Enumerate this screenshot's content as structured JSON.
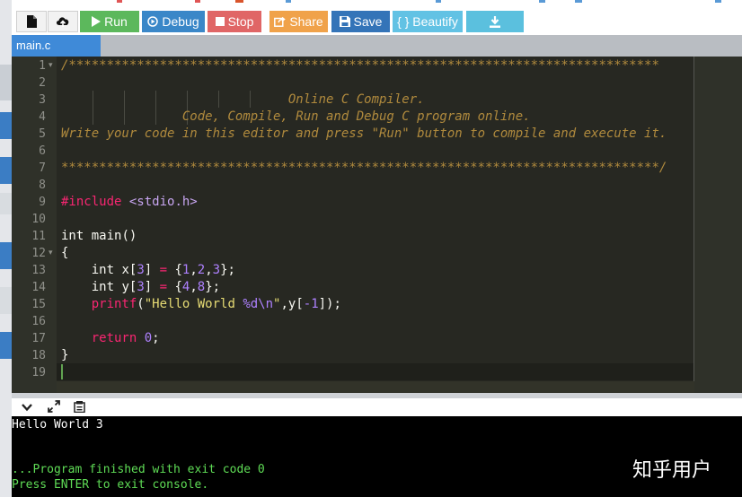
{
  "toolbar": {
    "new_file_icon": "file-icon",
    "upload_icon": "upload-icon",
    "run_label": "Run",
    "debug_label": "Debug",
    "stop_label": "Stop",
    "share_label": "Share",
    "save_label": "Save",
    "beautify_label": "{ } Beautify",
    "download_icon": "download-icon",
    "colors": {
      "run": "#5cb85c",
      "debug": "#3a87c8",
      "stop": "#e06666",
      "share": "#f0a24a",
      "save": "#3474b8",
      "beautify": "#62c2e4",
      "download": "#5bc0de"
    }
  },
  "tabs": [
    {
      "label": "main.c",
      "active": true
    }
  ],
  "editor": {
    "line_numbers": [
      "1",
      "2",
      "3",
      "4",
      "5",
      "6",
      "7",
      "8",
      "9",
      "10",
      "11",
      "12",
      "13",
      "14",
      "15",
      "16",
      "17",
      "18",
      "19"
    ],
    "fold_markers": [
      "1",
      "12"
    ],
    "code": {
      "l1": "/******************************************************************************",
      "l3": "                              Online C Compiler.",
      "l4": "                Code, Compile, Run and Debug C program online.",
      "l5": "Write your code in this editor and press \"Run\" button to compile and execute it.",
      "l7": "*******************************************************************************/",
      "l9_directive": "#include",
      "l9_header": "<stdio.h>",
      "l11_type": "int",
      "l11_rest": " main()",
      "l12": "{",
      "l13_type": "int",
      "l13_a": " x[",
      "l13_n": "3",
      "l13_b": "] ",
      "l13_eq": "=",
      "l13_c": " {",
      "l13_v1": "1",
      "l13_c1": ",",
      "l13_v2": "2",
      "l13_c2": ",",
      "l13_v3": "3",
      "l13_d": "};",
      "l14_type": "int",
      "l14_a": " y[",
      "l14_n": "3",
      "l14_b": "] ",
      "l14_eq": "=",
      "l14_c": " {",
      "l14_v1": "4",
      "l14_c1": ",",
      "l14_v2": "8",
      "l14_d": "};",
      "l15_fn": "printf",
      "l15_a": "(",
      "l15_str1": "\"Hello World ",
      "l15_fmt": "%d\\n",
      "l15_str2": "\"",
      "l15_b": ",y[",
      "l15_neg": "-1",
      "l15_c": "]);",
      "l17_kw": "return",
      "l17_num": "0",
      "l17_end": ";",
      "l18": "}"
    },
    "colors": {
      "background": "#272822",
      "comment": "#b08a3d",
      "number": "#ae81ff",
      "string": "#e6db74",
      "keyword": "#f92672"
    }
  },
  "console_toolbar": {
    "collapse_icon": "chevron-down-icon",
    "expand_icon": "expand-icon",
    "copy_icon": "copy-icon"
  },
  "console": {
    "output_line": "Hello World 3",
    "finish_line": "...Program finished with exit code 0",
    "exit_prompt": "Press ENTER to exit console.",
    "output_color": "#ffffff",
    "status_color": "#5fdc56"
  },
  "watermark": "知乎用户"
}
